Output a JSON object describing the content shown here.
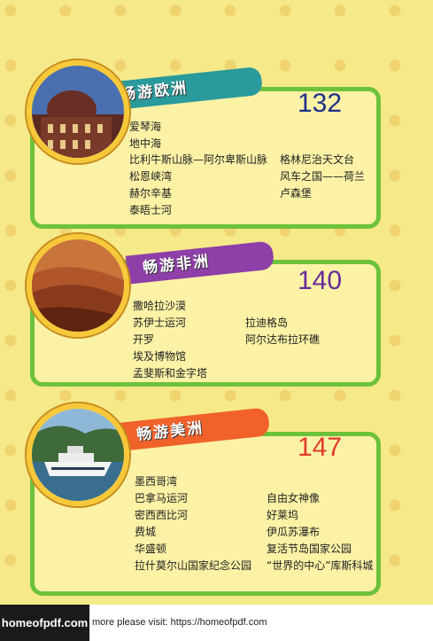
{
  "sections": [
    {
      "title": "畅游欧洲",
      "page": "132",
      "accent": "#2a9a9c",
      "page_color": "#1d2f8a",
      "left_items": [
        "爱琴海",
        "地中海",
        "比利牛斯山脉—阿尔卑斯山脉",
        "松恩峡湾",
        "赫尔辛基",
        "泰晤士河"
      ],
      "right_items": [
        "格林尼治天文台",
        "风车之国——荷兰",
        "卢森堡"
      ]
    },
    {
      "title": "畅游非洲",
      "page": "140",
      "accent": "#8e3fa8",
      "page_color": "#6a2a9a",
      "left_items": [
        "撒哈拉沙漠",
        "苏伊士运河",
        "开罗",
        "埃及博物馆",
        "孟斐斯和金字塔"
      ],
      "right_items": [
        "拉迪格岛",
        "阿尔达布拉环礁"
      ]
    },
    {
      "title": "畅游美洲",
      "page": "147",
      "accent": "#f0622a",
      "page_color": "#e33a2a",
      "left_items": [
        "墨西哥湾",
        "巴拿马运河",
        "密西西比河",
        "费城",
        "华盛顿",
        "拉什莫尔山国家纪念公园"
      ],
      "right_items": [
        "自由女神像",
        "好莱坞",
        "伊瓜苏瀑布",
        "复活节岛国家公园",
        "“世界的中心”库斯科城"
      ]
    }
  ],
  "footer": {
    "logo": "homeofpdf.com",
    "text": "more please visit: https://homeofpdf.com"
  }
}
